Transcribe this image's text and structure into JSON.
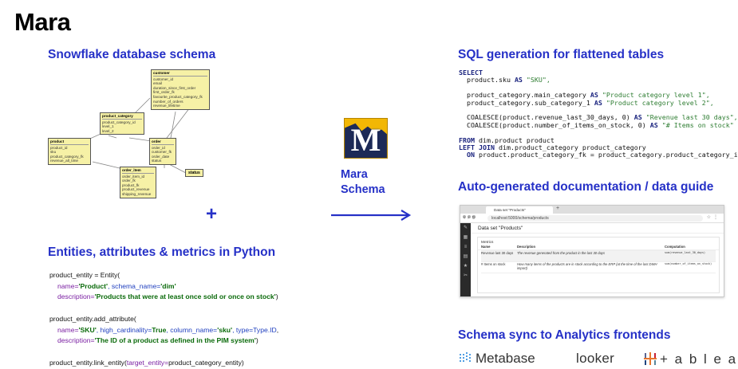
{
  "title": "Mara",
  "sections": {
    "snowflake": "Snowflake database schema",
    "entities": "Entities, attributes & metrics in Python",
    "sql": "SQL generation for flattened tables",
    "docs": "Auto-generated documentation / data guide",
    "sync": "Schema sync to Analytics frontends"
  },
  "plus": "+",
  "center": {
    "logo_letter": "M",
    "label_line1": "Mara",
    "label_line2": "Schema"
  },
  "er": {
    "customer": {
      "name": "customer",
      "fields": [
        "customer_id",
        "email",
        "duration_since_first_order",
        "first_order_fk",
        "favourite_product_category_fk",
        "number_of_orders",
        "revenue_lifetime"
      ]
    },
    "product_category": {
      "name": "product_category",
      "fields": [
        "product_category_id",
        "level_1",
        "level_2"
      ]
    },
    "product": {
      "name": "product",
      "fields": [
        "product_id",
        "sku",
        "product_category_fk",
        "revenue_all_time"
      ]
    },
    "order": {
      "name": "order",
      "fields": [
        "order_id",
        "customer_fk",
        "order_date",
        "status"
      ]
    },
    "order_item": {
      "name": "order_item",
      "fields": [
        "order_item_id",
        "order_fk",
        "product_fk",
        "product_revenue",
        "shipping_revenue"
      ]
    },
    "status": {
      "name": "status"
    }
  },
  "python": {
    "l1": "product_entity = Entity(",
    "l2_k1": "name=",
    "l2_v1": "'Product'",
    "l2_k2": ", schema_name=",
    "l2_v2": "'dim'",
    "l3_k": "description=",
    "l3_v": "'Products that were at least once sold or once on stock'",
    "l3_end": ")",
    "l4": "product_entity.add_attribute(",
    "l5_k1": "name=",
    "l5_v1": "'SKU'",
    "l5_k2": ", high_cardinality=",
    "l5_v2": "True",
    "l5_k3": ", column_name=",
    "l5_v3": "'sku'",
    "l5_k4": ", type=",
    "l5_v4": "Type.ID",
    "l5_end": ",",
    "l6_k": "description=",
    "l6_v": "'The ID of a product as defined in the PIM system'",
    "l6_end": ")",
    "l7a": "product_entity.link_entity(",
    "l7_k": "target_entity=",
    "l7b": "product_category_entity)"
  },
  "sql": {
    "select": "SELECT",
    "s1a": "  product.sku ",
    "as": "AS",
    "s1b": " \"SKU\",",
    "s2a": "  product_category.main_category ",
    "s2b": " \"Product category level 1\",",
    "s3a": "  product_category.sub_category_1 ",
    "s3b": " \"Product category level 2\",",
    "s4a": "  COALESCE(product.revenue_last_30_days, 0) ",
    "s4b": " \"Revenue last 30 days\",",
    "s5a": "  COALESCE(product.number_of_items_on_stock, 0) ",
    "s5b": " \"# Items on stock\"",
    "from": "FROM",
    "s6": " dim.product product",
    "join": "LEFT JOIN",
    "s7": " dim.product_category product_category",
    "on": "  ON",
    "s8": " product.product_category_fk = product_category.product_category_id"
  },
  "browser": {
    "tab_title": "Data set \"Products\"",
    "tab_new": "+",
    "url": "localhost:5000/schema/products",
    "page_title": "Data set \"Products\"",
    "card_title": "Metrics",
    "headers": [
      "Name",
      "Description",
      "Computation"
    ],
    "rows": [
      {
        "name": "Revenue last 30 days",
        "description": "The revenue generated from the product in the last 30 days",
        "computation": "sum(revenue_last_30_days)"
      },
      {
        "name": "# Items on stock",
        "description": "How many items of the products are in stock according to the ERP (at the time of the last DWH import)",
        "computation": "sum(number_of_items_on_stock)"
      }
    ]
  },
  "logos": {
    "metabase": "Metabase",
    "looker": "looker",
    "tableau": "+ a b l e a u"
  },
  "colors": {
    "accent": "#2631c7",
    "er_fill": "#f6f1a6",
    "logo_yellow": "#f2b705",
    "logo_navy": "#1d2a57",
    "metabase_blue": "#509ee3",
    "tableau_orange": "#e8762d"
  },
  "icons": [
    "arrow-right-icon",
    "mara-logo-icon",
    "metabase-logo-icon",
    "tableau-logo-icon"
  ]
}
